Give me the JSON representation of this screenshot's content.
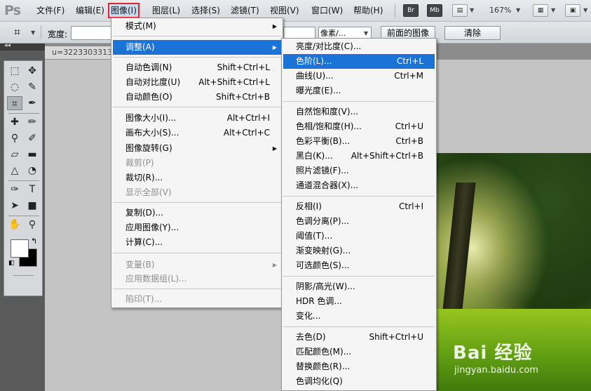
{
  "app": {
    "logo": "Ps"
  },
  "menubar": {
    "items": [
      "文件(F)",
      "编辑(E)",
      "图像(I)",
      "图层(L)",
      "选择(S)",
      "滤镜(T)",
      "视图(V)",
      "窗口(W)",
      "帮助(H)"
    ],
    "bridge_btn": "Br",
    "minibridge_btn": "Mb",
    "zoom": "167%"
  },
  "options": {
    "width_label": "宽度:",
    "unit_select": "像素/...",
    "front_image_btn": "前面的图像",
    "clear_btn": "清除"
  },
  "document": {
    "tab_title": "u=3223303313",
    "watermark_brand": "Bai 经验",
    "watermark_url": "jingyan.baidu.com"
  },
  "image_menu": {
    "mode": "模式(M)",
    "adjust": "调整(A)",
    "auto_tone": "自动色调(N)",
    "auto_tone_sc": "Shift+Ctrl+L",
    "auto_contrast": "自动对比度(U)",
    "auto_contrast_sc": "Alt+Shift+Ctrl+L",
    "auto_color": "自动颜色(O)",
    "auto_color_sc": "Shift+Ctrl+B",
    "image_size": "图像大小(I)...",
    "image_size_sc": "Alt+Ctrl+I",
    "canvas_size": "画布大小(S)...",
    "canvas_size_sc": "Alt+Ctrl+C",
    "image_rotate": "图像旋转(G)",
    "crop": "裁剪(P)",
    "trim": "裁切(R)...",
    "reveal_all": "显示全部(V)",
    "duplicate": "复制(D)...",
    "apply_image": "应用图像(Y)...",
    "calculations": "计算(C)...",
    "variables": "变量(B)",
    "apply_dataset": "应用数据组(L)...",
    "trap": "陷印(T)..."
  },
  "adjust_menu": {
    "brightness": "亮度/对比度(C)...",
    "levels": "色阶(L)...",
    "levels_sc": "Ctrl+L",
    "curves": "曲线(U)...",
    "curves_sc": "Ctrl+M",
    "exposure": "曝光度(E)...",
    "vibrance": "自然饱和度(V)...",
    "hue_sat": "色相/饱和度(H)...",
    "hue_sat_sc": "Ctrl+U",
    "color_balance": "色彩平衡(B)...",
    "color_balance_sc": "Ctrl+B",
    "bw": "黑白(K)...",
    "bw_sc": "Alt+Shift+Ctrl+B",
    "photo_filter": "照片滤镜(F)...",
    "channel_mixer": "通道混合器(X)...",
    "invert": "反相(I)",
    "invert_sc": "Ctrl+I",
    "posterize": "色调分离(P)...",
    "threshold": "阈值(T)...",
    "gradient_map": "渐变映射(G)...",
    "selective_color": "可选颜色(S)...",
    "shadows_highlights": "阴影/高光(W)...",
    "hdr_toning": "HDR 色调...",
    "variations": "变化...",
    "desaturate": "去色(D)",
    "desaturate_sc": "Shift+Ctrl+U",
    "match_color": "匹配颜色(M)...",
    "replace_color": "替换颜色(R)...",
    "equalize": "色调均化(Q)"
  },
  "colors": {
    "highlight": "#1c73d6",
    "active_menu_border": "#e0262a"
  }
}
